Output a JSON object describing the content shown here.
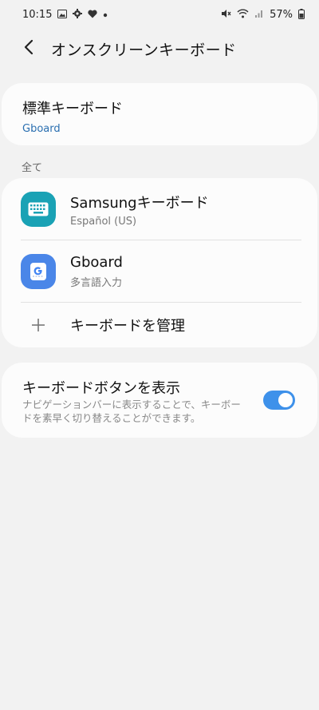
{
  "status_bar": {
    "time": "10:15",
    "battery": "57%",
    "left_icons": [
      "gallery-icon",
      "gear-icon",
      "heart-icon",
      "dot-icon"
    ],
    "right_icons": [
      "mute-icon",
      "wifi-icon",
      "signal-icon",
      "battery-icon"
    ]
  },
  "header": {
    "title": "オンスクリーンキーボード",
    "back_icon": "chevron-left-icon"
  },
  "default_keyboard": {
    "label": "標準キーボード",
    "value": "Gboard"
  },
  "section": {
    "all_label": "全て"
  },
  "keyboards": [
    {
      "name": "Samsungキーボード",
      "sub": "Español (US)",
      "icon": "samsung-keyboard-icon",
      "color": "#1aa2b5"
    },
    {
      "name": "Gboard",
      "sub": "多言語入力",
      "icon": "gboard-icon",
      "color": "#4a86e8"
    }
  ],
  "manage": {
    "label": "キーボードを管理",
    "icon": "plus-icon"
  },
  "keyboard_button": {
    "title": "キーボードボタンを表示",
    "description": "ナビゲーションバーに表示することで、キーボードを素早く切り替えることができます。",
    "enabled": true,
    "accent": "#3e91ea"
  }
}
